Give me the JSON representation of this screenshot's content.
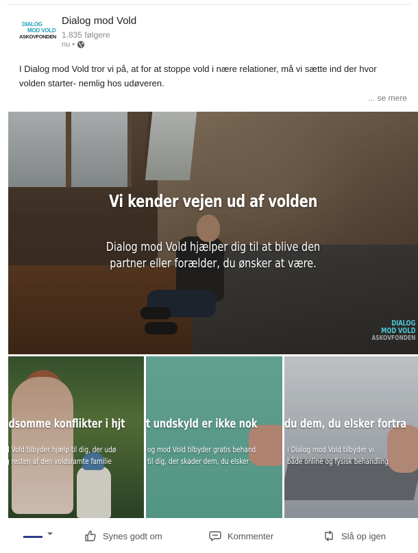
{
  "post": {
    "org_name": "Dialog mod Vold",
    "followers": "1.835 følgere",
    "time": "nu •",
    "logo": {
      "line1": "DIALOG",
      "line2": "MOD VOLD",
      "line3": "ASKOVFONDEN"
    },
    "text": "I Dialog mod Vold tror vi på, at for at stoppe vold i nære relationer, må vi sætte ind der hvor volden starter- nemlig hos udøveren.",
    "see_more": "... se mere"
  },
  "hero": {
    "title": "Vi kender vejen ud af volden",
    "subtitle_line1": "Dialog mod Vold hjælper dig til at blive den",
    "subtitle_line2": "partner eller forælder, du ønsker at være.",
    "watermark": {
      "line1": "DIALOG",
      "line2": "MOD VOLD",
      "line3": "ASKOVFONDEN"
    }
  },
  "tiles": [
    {
      "title": "ldsomme konflikter i hjt",
      "sub_line1": "d Vold tilbyder hjælp til dig, der udø",
      "sub_line2": "g resten af den voldsramte familie"
    },
    {
      "title": "t undskyld er ikke nok",
      "sub_line1": "og mod Vold tilbyder gratis behand",
      "sub_line2": "til dig, der skader dem, du elsker"
    },
    {
      "title": "du dem, du elsker fortra",
      "sub_line1": "I Dialog mod Vold tilbyder vi",
      "sub_line2": "både online og fysisk behandling"
    }
  ],
  "actions": {
    "like": "Synes godt om",
    "comment": "Kommenter",
    "repost": "Slå op igen"
  },
  "colors": {
    "brand_teal": "#1aa0b4",
    "text": "#1d1d1d",
    "muted": "#8a8a8a"
  },
  "icons": [
    "globe-icon",
    "chevron-down-icon",
    "thumbs-up-icon",
    "comment-icon",
    "repost-icon"
  ]
}
